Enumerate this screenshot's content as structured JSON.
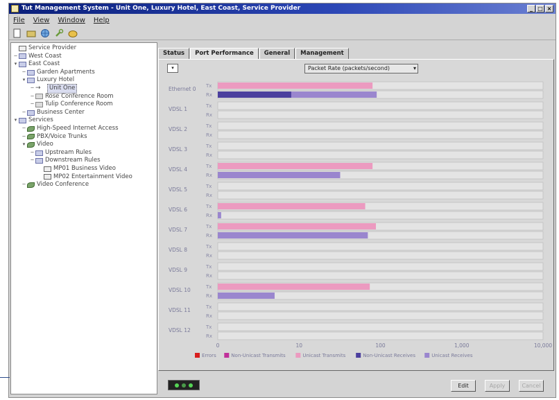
{
  "window": {
    "title": "Tut Management System - Unit One, Luxury Hotel, East Coast, Service Provider",
    "controls": [
      "_",
      "□",
      "×"
    ]
  },
  "menu": [
    "File",
    "View",
    "Window",
    "Help"
  ],
  "toolbar_icons": [
    "new-icon",
    "open-icon",
    "globe-icon",
    "wrench-icon",
    "help-icon"
  ],
  "tree": [
    {
      "label": "Service Provider",
      "indent": 0,
      "type": "root",
      "expander": ""
    },
    {
      "label": "West Coast",
      "indent": 0,
      "type": "folder",
      "expander": "─"
    },
    {
      "label": "East Coast",
      "indent": 0,
      "type": "folder",
      "expander": "▾"
    },
    {
      "label": "Garden Apartments",
      "indent": 1,
      "type": "folder",
      "expander": "─"
    },
    {
      "label": "Luxury Hotel",
      "indent": 1,
      "type": "folder",
      "expander": "▾"
    },
    {
      "label": "Unit One",
      "indent": 2,
      "type": "arrow",
      "expander": "─",
      "selected": true
    },
    {
      "label": "Rose Conference Room",
      "indent": 2,
      "type": "room",
      "expander": "─"
    },
    {
      "label": "Tulip Conference Room",
      "indent": 2,
      "type": "room",
      "expander": "─"
    },
    {
      "label": "Business Center",
      "indent": 1,
      "type": "folder",
      "expander": "─"
    },
    {
      "label": "Services",
      "indent": 0,
      "type": "folder",
      "expander": "▾"
    },
    {
      "label": "High-Speed Internet Access",
      "indent": 1,
      "type": "svc",
      "expander": "─"
    },
    {
      "label": "PBX/Voice Trunks",
      "indent": 1,
      "type": "svc",
      "expander": "─"
    },
    {
      "label": "Video",
      "indent": 1,
      "type": "svc",
      "expander": "▾"
    },
    {
      "label": "Upstream Rules",
      "indent": 2,
      "type": "folder",
      "expander": "─"
    },
    {
      "label": "Downstream Rules",
      "indent": 2,
      "type": "folder",
      "expander": "─"
    },
    {
      "label": "MP01 Business Video",
      "indent": 3,
      "type": "doc",
      "expander": ""
    },
    {
      "label": "MP02 Entertainment Video",
      "indent": 3,
      "type": "doc",
      "expander": ""
    },
    {
      "label": "Video Conference",
      "indent": 1,
      "type": "svc",
      "expander": "─"
    }
  ],
  "tabs": [
    {
      "label": "Status",
      "active": false
    },
    {
      "label": "Port Performance",
      "active": true
    },
    {
      "label": "General",
      "active": false
    },
    {
      "label": "Management",
      "active": false
    }
  ],
  "controls": {
    "small_select": "▾",
    "metric_select": "Packet Rate (packets/second)"
  },
  "buttons": {
    "edit": "Edit",
    "apply": "Apply",
    "cancel": "Cancel"
  },
  "colors": {
    "errors": "#d81e1e",
    "non_unicast_tx": "#c0309a",
    "unicast_tx": "#ec9ac0",
    "non_unicast_rx": "#4b3f9e",
    "unicast_rx": "#9a86ce"
  },
  "chart_data": {
    "type": "bar",
    "orientation": "horizontal",
    "x_scale": "log",
    "xlim": [
      1,
      10000
    ],
    "x_ticks": [
      "0",
      "10",
      "100",
      "1,000",
      "10,000"
    ],
    "categories": [
      "Ethernet 0",
      "VDSL 1",
      "VDSL 2",
      "VDSL 3",
      "VDSL 4",
      "VDSL 5",
      "VDSL 6",
      "VDSL 7",
      "VDSL 8",
      "VDSL 9",
      "VDSL 10",
      "VDSL 11",
      "VDSL 12"
    ],
    "sub_rows": [
      "Tx",
      "Rx"
    ],
    "series": [
      {
        "name": "Errors",
        "key": "errors",
        "row": "Tx",
        "values": [
          0,
          0,
          0,
          0,
          0,
          0,
          0,
          0,
          0,
          0,
          0,
          0,
          0
        ]
      },
      {
        "name": "Non-Unicast Transmits",
        "key": "non_unicast_tx",
        "row": "Tx",
        "values": [
          0,
          0,
          0,
          0,
          0,
          0,
          0,
          0,
          0,
          0,
          0,
          0,
          0
        ]
      },
      {
        "name": "Unicast Transmits",
        "key": "unicast_tx",
        "row": "Tx",
        "values": [
          80,
          0,
          0,
          0,
          80,
          0,
          65,
          88,
          0,
          0,
          74,
          0,
          0
        ]
      },
      {
        "name": "Non-Unicast Receives",
        "key": "non_unicast_rx",
        "row": "Rx",
        "values": [
          8,
          0,
          0,
          0,
          0,
          0,
          0,
          0,
          0,
          0,
          0,
          0,
          0
        ]
      },
      {
        "name": "Unicast Receives",
        "key": "unicast_rx",
        "row": "Rx",
        "values": [
          90,
          0,
          0,
          0,
          32,
          0,
          1.1,
          70,
          0,
          0,
          5,
          0,
          0
        ]
      }
    ],
    "legend_position": "bottom",
    "grid": false
  }
}
